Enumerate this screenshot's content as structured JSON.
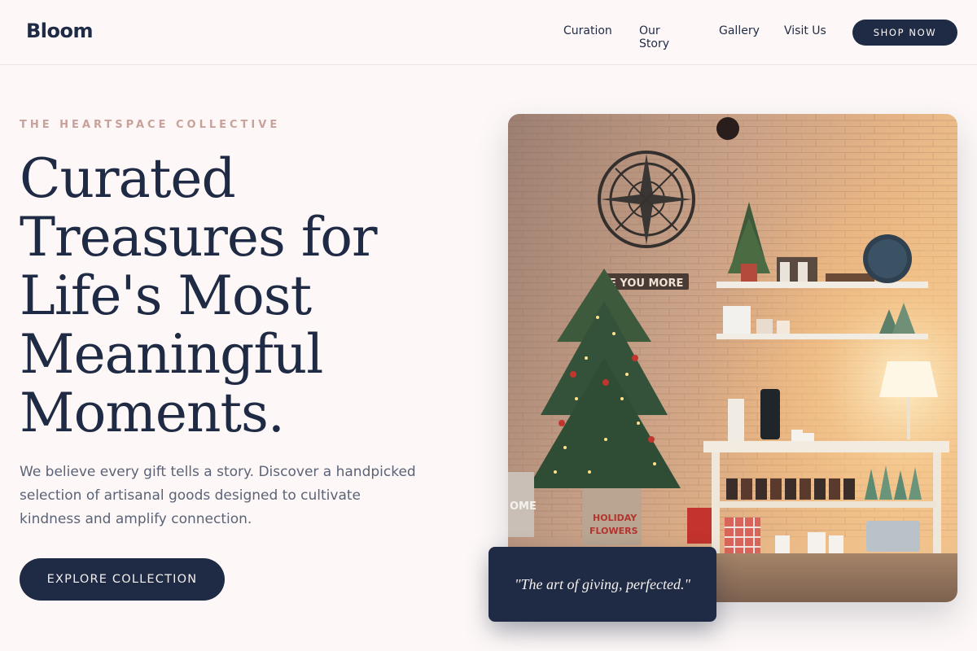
{
  "header": {
    "logo": "Bloom",
    "nav": [
      "Curation",
      "Our Story",
      "Gallery",
      "Visit Us"
    ],
    "cta": "SHOP NOW"
  },
  "hero": {
    "eyebrow": "THE HEARTSPACE COLLECTIVE",
    "headline_lines": [
      "Curated",
      "Treasures for",
      "Life's Most",
      "Meaningful",
      "Moments."
    ],
    "subcopy_lines": [
      "We believe every gift tells a story. Discover a handpicked",
      "selection of artisanal goods designed to cultivate",
      "kindness and amplify connection."
    ],
    "button": "EXPLORE COLLECTION",
    "quote": "\"The art of giving, perfected.\""
  },
  "photo": {
    "sign_text": "E YOU MORE",
    "crate_text_1": "HOLIDAY",
    "crate_text_2": "FLOWERS",
    "pillow_text": "OME"
  },
  "colors": {
    "navy": "#1f2a44",
    "background": "#fdf8f7",
    "eyebrow": "#c9a19b",
    "body_text": "#5a6377"
  }
}
